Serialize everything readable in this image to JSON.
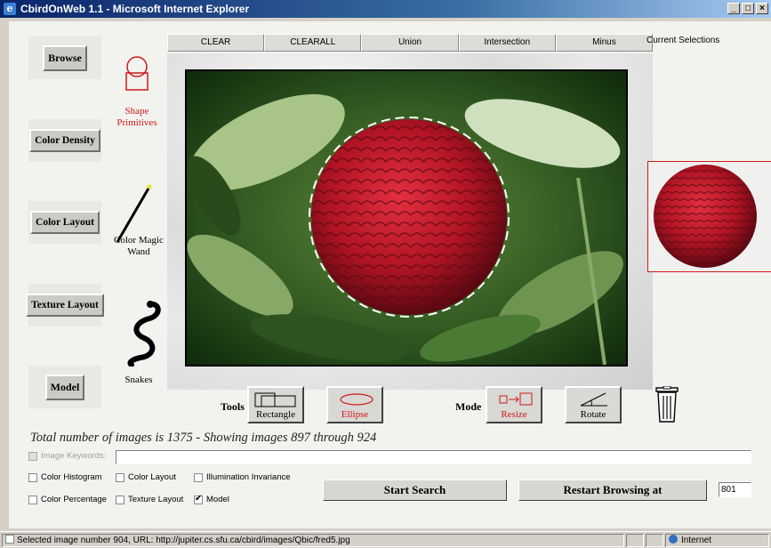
{
  "window": {
    "title": "CbirdOnWeb 1.1 - Microsoft Internet Explorer",
    "buttons": [
      "_",
      "□",
      "×"
    ]
  },
  "left_buttons": [
    "Browse",
    "Color Density",
    "Color Layout",
    "Texture Layout",
    "Model"
  ],
  "tools": {
    "shape_label": "Shape Primitives",
    "wand_label": "Color Magic Wand",
    "snakes_label": "Snakes"
  },
  "tabs": [
    "CLEAR",
    "CLEARALL",
    "Union",
    "Intersection",
    "Minus"
  ],
  "current_selections_label": "Current Selections",
  "bottom_tools": {
    "tools_label": "Tools",
    "rectangle_label": "Rectangle",
    "ellipse_label": "Ellipse",
    "mode_label": "Mode",
    "resize_label": "Resize",
    "rotate_label": "Rotate"
  },
  "total_text": "Total number of images is 1375 - Showing images 897 through 924",
  "keywords": {
    "label": "Image Keywords:",
    "value": ""
  },
  "options": {
    "color_histogram": "Color Histogram",
    "color_layout": "Color Layout",
    "illumination_invariance": "Illumination Invariance",
    "color_percentage": "Color Percentage",
    "texture_layout": "Texture Layout",
    "model": "Model"
  },
  "actions": {
    "start_search": "Start Search",
    "restart_browsing": "Restart Browsing at",
    "restart_value": "801"
  },
  "statusbar": {
    "text": "Selected image number 904, URL: http://jupiter.cs.sfu.ca/cbird/images/Qbic/fred5.jpg",
    "zone": "Internet"
  },
  "colors": {
    "accent_red": "#d01818",
    "title_blue": "#0a246a"
  }
}
